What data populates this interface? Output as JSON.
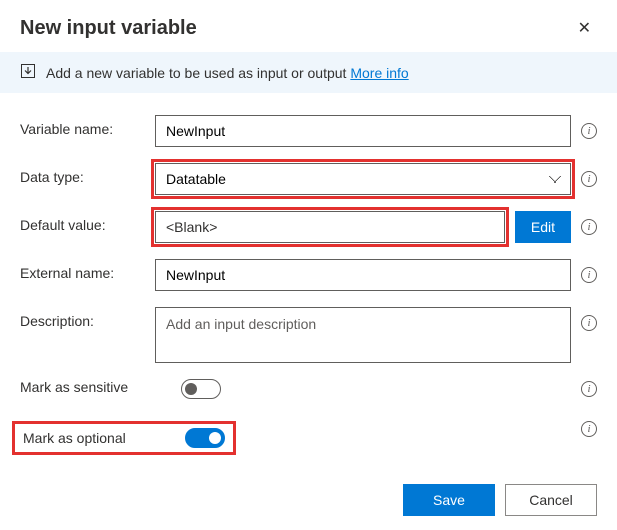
{
  "header": {
    "title": "New input variable"
  },
  "info_bar": {
    "text": "Add a new variable to be used as input or output ",
    "link_text": "More info"
  },
  "fields": {
    "variable_name": {
      "label": "Variable name:",
      "value": "NewInput"
    },
    "data_type": {
      "label": "Data type:",
      "value": "Datatable"
    },
    "default_value": {
      "label": "Default value:",
      "value": "<Blank>",
      "edit_label": "Edit"
    },
    "external_name": {
      "label": "External name:",
      "value": "NewInput"
    },
    "description": {
      "label": "Description:",
      "placeholder": "Add an input description",
      "value": ""
    },
    "mark_sensitive": {
      "label": "Mark as sensitive",
      "on": false
    },
    "mark_optional": {
      "label": "Mark as optional",
      "on": true
    }
  },
  "footer": {
    "save": "Save",
    "cancel": "Cancel"
  }
}
